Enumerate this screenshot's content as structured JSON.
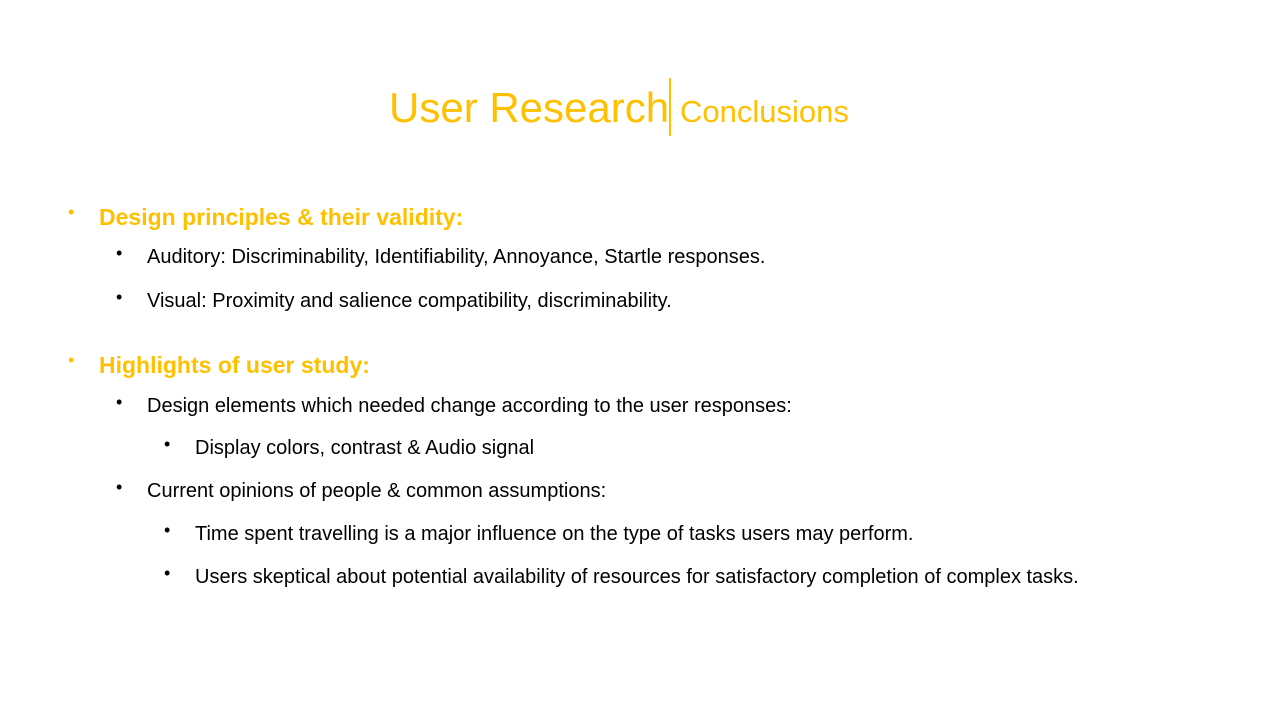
{
  "title": {
    "main": "User Research",
    "sub": "Conclusions"
  },
  "bullet_glyph": "•",
  "colors": {
    "accent": "#FFC000",
    "text": "#000000",
    "background": "#FFFFFF"
  },
  "sections": [
    {
      "heading": "Design principles & their validity:",
      "items": [
        "Auditory: Discriminability, Identifiability, Annoyance, Startle responses.",
        "Visual: Proximity and salience compatibility, discriminability."
      ]
    },
    {
      "heading": "Highlights of user study:",
      "items": [
        {
          "text": "Design elements which needed change according to the user responses:",
          "subitems": [
            "Display colors, contrast & Audio signal"
          ]
        },
        {
          "text": "Current opinions of people & common assumptions:",
          "subitems": [
            "Time spent travelling is a major influence on the type of tasks users may perform.",
            "Users skeptical about potential availability of resources for satisfactory completion of complex tasks."
          ]
        }
      ]
    }
  ]
}
